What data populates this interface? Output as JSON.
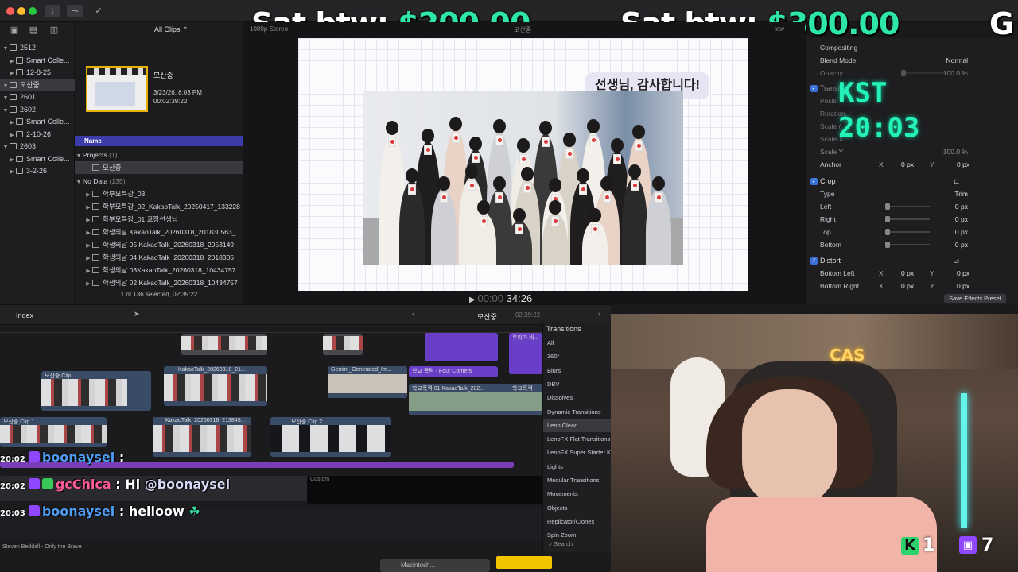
{
  "overlay": {
    "tip1_prefix": "Sat  btw: ",
    "tip1_amount": "$200.00",
    "tip2_prefix": "Sat  btw: ",
    "tip2_amount": "$300.00",
    "tip3_prefix": "G",
    "clock_label": "KST",
    "clock_time": "20:03"
  },
  "toolbar": {
    "all_clips": "All Clips"
  },
  "libraries": {
    "items": [
      {
        "label": "2512",
        "level": 0
      },
      {
        "label": "Smart Colle...",
        "level": 1
      },
      {
        "label": "12-8-25",
        "level": 1
      },
      {
        "label": "모산중",
        "level": 0
      },
      {
        "label": "2601",
        "level": 0
      },
      {
        "label": "2602",
        "level": 0
      },
      {
        "label": "Smart Colle...",
        "level": 1
      },
      {
        "label": "2-10-26",
        "level": 1
      },
      {
        "label": "2603",
        "level": 0
      },
      {
        "label": "Smart Colle...",
        "level": 1
      },
      {
        "label": "3-2-26",
        "level": 1
      }
    ]
  },
  "browser": {
    "clip_title": "모산중",
    "clip_date": "3/23/26, 8:03 PM",
    "clip_duration": "00:02:39:22",
    "name_header": "Name",
    "projects_label": "Projects",
    "projects_count": "(1)",
    "project_item": "모산중",
    "nodata_label": "No Data",
    "nodata_count": "(135)",
    "rows": [
      "학부모특강_03",
      "학부모특강_02_KakaoTalk_20250417_133228",
      "학부모특강_01 교장선생님",
      "학생의날 KakaoTalk_20260318_201830563_",
      "학생의날 05 KakaoTalk_20260318_2053149",
      "학생의날 04 KakaoTalk_20260318_2018305",
      "학생의날 03KakaoTalk_20260318_10434757",
      "학생의날 02 KakaoTalk_20260318_10434757"
    ],
    "footer": "1 of 136 selected, 02:39:22"
  },
  "viewer": {
    "header_left": "1080p",
    "header_audio": "Stereo",
    "header_mid": "모산중",
    "header_view": "iew",
    "speech": "선생님, 감사합니다!",
    "timecode_dim": "00:00",
    "timecode": "34:26"
  },
  "inspector": {
    "compositing": "Compositing",
    "blend_mode_label": "Blend Mode",
    "blend_mode_value": "Normal",
    "opacity_label": "Opacity",
    "opacity_value": "100.0 %",
    "transform_label": "Transf",
    "position_label": "Positi",
    "rotation_label": "Rotation",
    "scale_label": "Scale (",
    "scale_x_label": "Scale X",
    "scale_y_label": "Scale Y",
    "scale_y_value": "100.0 %",
    "anchor_label": "Anchor",
    "anchor_x": "0 px",
    "anchor_y": "0 px",
    "crop_label": "Crop",
    "type_label": "Type",
    "type_value": "Trim",
    "left_label": "Left",
    "right_label": "Right",
    "top_label": "Top",
    "bottom_label": "Bottom",
    "crop_value": "0 px",
    "distort_label": "Distort",
    "bottom_left_label": "Bottom Left",
    "bottom_right_label": "Bottom Right",
    "x_label": "X",
    "y_label": "Y",
    "zero_px": "0 px",
    "save_preset": "Save Effects Preset"
  },
  "timeline": {
    "index_label": "Index",
    "project_name": "모산중",
    "project_duration": "02:39:22",
    "clips": [
      {
        "label": "모산중 Clip"
      },
      {
        "label": "KakaoTalk_20260318_21..."
      },
      {
        "label": "Gemini_Generated_Im..."
      },
      {
        "label": "학교 폭력 - Four Corners"
      },
      {
        "label": "학교폭력 01 KakaoTalk_202..."
      },
      {
        "label": "학교폭력"
      },
      {
        "label": "모산중 Clip 1"
      },
      {
        "label": "KakaoTalk_20260318_213845..."
      },
      {
        "label": "모산중 Clip 2"
      },
      {
        "label": "우리가 바..."
      },
      {
        "label": "Custom"
      }
    ],
    "song": "Steven Beddall - Only the Brave"
  },
  "transitions": {
    "header": "Transitions",
    "items": [
      "All",
      "360°",
      "Blurs",
      "DBV",
      "Dissolves",
      "Dynamic Transitions",
      "Leno Clean",
      "LenoFX Flat Transitions",
      "LenoFX Super Starter K",
      "Lights",
      "Modular Transitions",
      "Movements",
      "Objects",
      "Replicator/Clones",
      "Spin Zoom"
    ],
    "selected_index": 6,
    "search": "Search"
  },
  "chat": [
    {
      "time": "20:02",
      "user": "boonaysel",
      "message": ":",
      "user_color": "blue"
    },
    {
      "time": "20:02",
      "user": "gcChica",
      "message": ": Hi ",
      "mention": "@boonaysel",
      "user_color": "pink"
    },
    {
      "time": "20:03",
      "user": "boonaysel",
      "message": ": helloow",
      "user_color": "blue"
    }
  ],
  "webcam": {
    "sign": "CAS",
    "kick_count": "1",
    "twitch_count": "7",
    "kick_letter": "K"
  },
  "dock": {
    "mac_label": "Macintosh..."
  }
}
